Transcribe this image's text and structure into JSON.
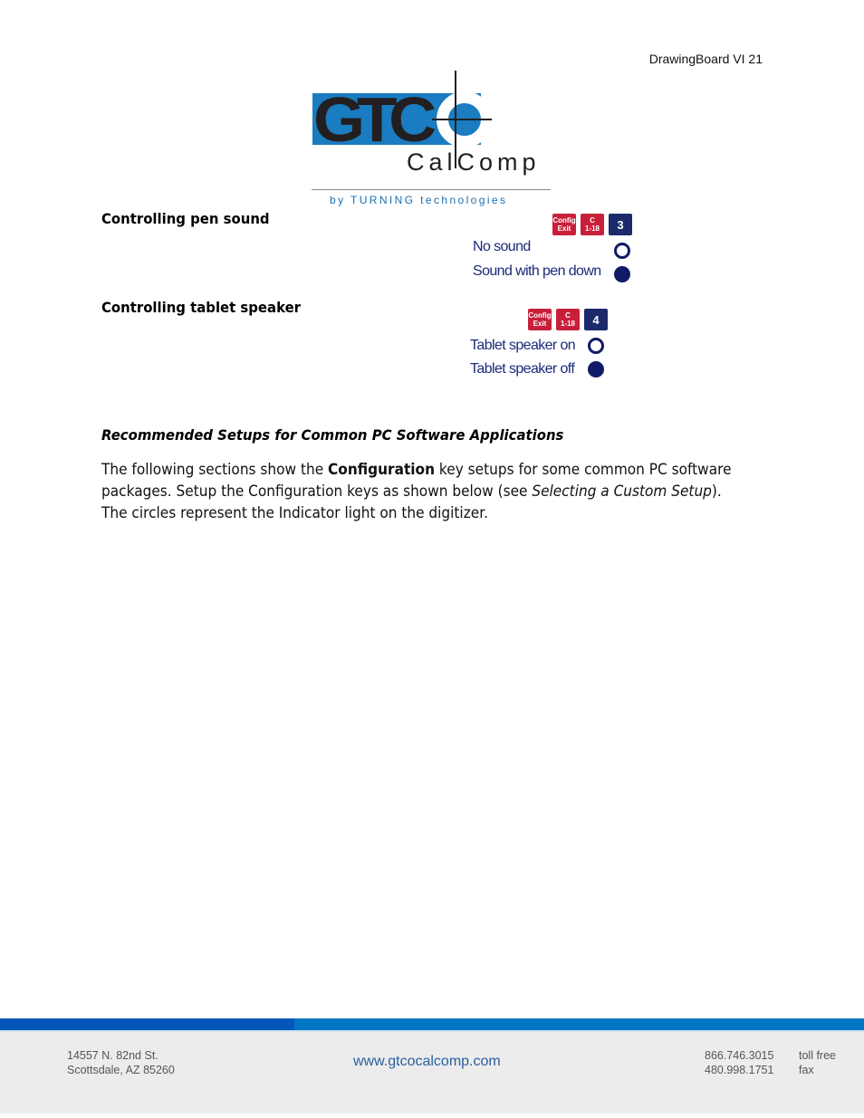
{
  "header": {
    "running_title": "DrawingBoard VI 21"
  },
  "logo": {
    "wordmark": "GTC",
    "subbrand": "CalComp",
    "tagline": "by TURNING technologies"
  },
  "sections": [
    {
      "title": "Controlling pen sound",
      "keys": [
        {
          "label_top": "Config",
          "label_bottom": "Exit",
          "color": "#c8203a"
        },
        {
          "label_top": "C",
          "label_bottom": "1-18",
          "color": "#c8203a"
        },
        {
          "label_top": "3",
          "label_bottom": "",
          "color": "#1b2a6b"
        }
      ],
      "options": [
        {
          "label": "No sound",
          "indicator": "off"
        },
        {
          "label": "Sound with pen down",
          "indicator": "on"
        }
      ]
    },
    {
      "title": "Controlling tablet speaker",
      "keys": [
        {
          "label_top": "Config",
          "label_bottom": "Exit",
          "color": "#c8203a"
        },
        {
          "label_top": "C",
          "label_bottom": "1-18",
          "color": "#c8203a"
        },
        {
          "label_top": "4",
          "label_bottom": "",
          "color": "#1b2a6b"
        }
      ],
      "options": [
        {
          "label": "Tablet speaker on",
          "indicator": "off"
        },
        {
          "label": "Tablet speaker off",
          "indicator": "on"
        }
      ]
    }
  ],
  "recommended": {
    "heading": "Recommended Setups for Common PC Software Applications",
    "para_1": "The following sections show the ",
    "para_bold": "Configuration",
    "para_2": " key setups for some common PC software packages.  Setup the Configuration keys as shown below (see ",
    "para_italic": "Selecting a Custom Setup",
    "para_3": ").  The circles represent the Indicator light on the digitizer."
  },
  "footer": {
    "address_line1": "14557 N. 82nd St.",
    "address_line2": "Scottsdale, AZ 85260",
    "website": "www.gtcocalcomp.com",
    "phones": [
      {
        "number": "866.746.3015",
        "label": "toll free"
      },
      {
        "number": "480.998.1751",
        "label": "fax"
      }
    ],
    "bar_colors": {
      "left": "#0456b8",
      "right": "#0077c4"
    }
  }
}
